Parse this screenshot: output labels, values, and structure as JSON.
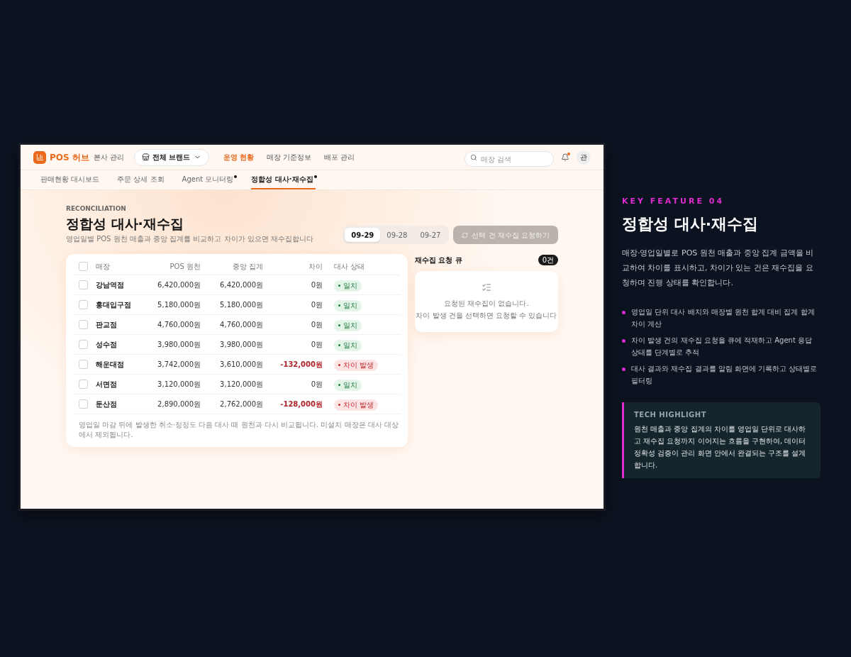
{
  "app": {
    "logo": "POS 허브",
    "subtitle": "본사 관리",
    "brand_select": "전체 브랜드",
    "nav": [
      {
        "label": "운영 현황",
        "selected": true
      },
      {
        "label": "매장 기준정보",
        "selected": false
      },
      {
        "label": "배포 관리",
        "selected": false
      }
    ],
    "search": {
      "placeholder": "매장 검색"
    },
    "notification_dot": true,
    "avatar": "관"
  },
  "subtabs": [
    {
      "label": "판매현황 대시보드",
      "selected": false,
      "dot": false
    },
    {
      "label": "주문 상세 조회",
      "selected": false,
      "dot": false
    },
    {
      "label": "Agent 모니터링",
      "selected": false,
      "dot": true
    },
    {
      "label": "정합성 대사·재수집",
      "selected": true,
      "dot": true
    }
  ],
  "page": {
    "eyebrow": "RECONCILIATION",
    "title": "정합성 대사·재수집",
    "description": "영업일별 POS 원천 매출과 중앙 집계를 비교하고 차이가 있으면 재수집합니다",
    "dates": [
      {
        "label": "09-29",
        "selected": true
      },
      {
        "label": "09-28",
        "selected": false
      },
      {
        "label": "09-27",
        "selected": false
      }
    ],
    "action": {
      "label": "선택 건 재수집 요청하기",
      "disabled": true
    }
  },
  "table": {
    "select_all": false,
    "columns": [
      "매장",
      "POS 원천",
      "중앙 집계",
      "차이",
      "대사 상태"
    ],
    "rows": [
      {
        "checked": false,
        "store": "강남역점",
        "pos": "6,420,000원",
        "central": "6,420,000원",
        "diff": "0원",
        "status": {
          "kind": "match",
          "label": "일치"
        }
      },
      {
        "checked": false,
        "store": "홍대입구점",
        "pos": "5,180,000원",
        "central": "5,180,000원",
        "diff": "0원",
        "status": {
          "kind": "match",
          "label": "일치"
        }
      },
      {
        "checked": false,
        "store": "판교점",
        "pos": "4,760,000원",
        "central": "4,760,000원",
        "diff": "0원",
        "status": {
          "kind": "match",
          "label": "일치"
        }
      },
      {
        "checked": false,
        "store": "성수점",
        "pos": "3,980,000원",
        "central": "3,980,000원",
        "diff": "0원",
        "status": {
          "kind": "match",
          "label": "일치"
        }
      },
      {
        "checked": false,
        "store": "해운대점",
        "pos": "3,742,000원",
        "central": "3,610,000원",
        "diff": "-132,000원",
        "status": {
          "kind": "mismatch",
          "label": "차이 발생"
        }
      },
      {
        "checked": false,
        "store": "서면점",
        "pos": "3,120,000원",
        "central": "3,120,000원",
        "diff": "0원",
        "status": {
          "kind": "match",
          "label": "일치"
        }
      },
      {
        "checked": false,
        "store": "둔산점",
        "pos": "2,890,000원",
        "central": "2,762,000원",
        "diff": "-128,000원",
        "status": {
          "kind": "mismatch",
          "label": "차이 발생"
        }
      }
    ],
    "footnote": "영업일 마감 뒤에 발생한 취소·정정도 다음 대사 때 원천과 다시 비교됩니다. 미설치 매장은 대사 대상에서 제외됩니다."
  },
  "queue": {
    "title": "재수집 요청 큐",
    "count": "0건",
    "empty_lines": [
      "요청된 재수집이 없습니다.",
      "차이 발생 건을 선택하면 요청할 수 있습니다"
    ]
  },
  "feature": {
    "eyebrow": "KEY FEATURE 04",
    "title": "정합성 대사·재수집",
    "description": "매장·영업일별로 POS 원천 매출과 중앙 집계 금액을 비교하여 차이를 표시하고, 차이가 있는 건은 재수집을 요청하며 진행 상태를 확인합니다.",
    "bullets": [
      "영업일 단위 대사 배치와 매장별 원천 합계 대비 집계 합계 차이 계산",
      "차이 발생 건의 재수집 요청을 큐에 적재하고 Agent 응답 상태를 단계별로 추적",
      "대사 결과와 재수집 결과를 알림 화면에 기록하고 상태별로 필터링"
    ],
    "highlight": {
      "title": "TECH HIGHLIGHT",
      "text": "원천 매출과 중앙 집계의 차이를 영업일 단위로 대사하고 재수집 요청까지 이어지는 흐름을 구현하여, 데이터 정확성 검증이 관리 화면 안에서 완결되는 구조를 설계합니다."
    }
  }
}
